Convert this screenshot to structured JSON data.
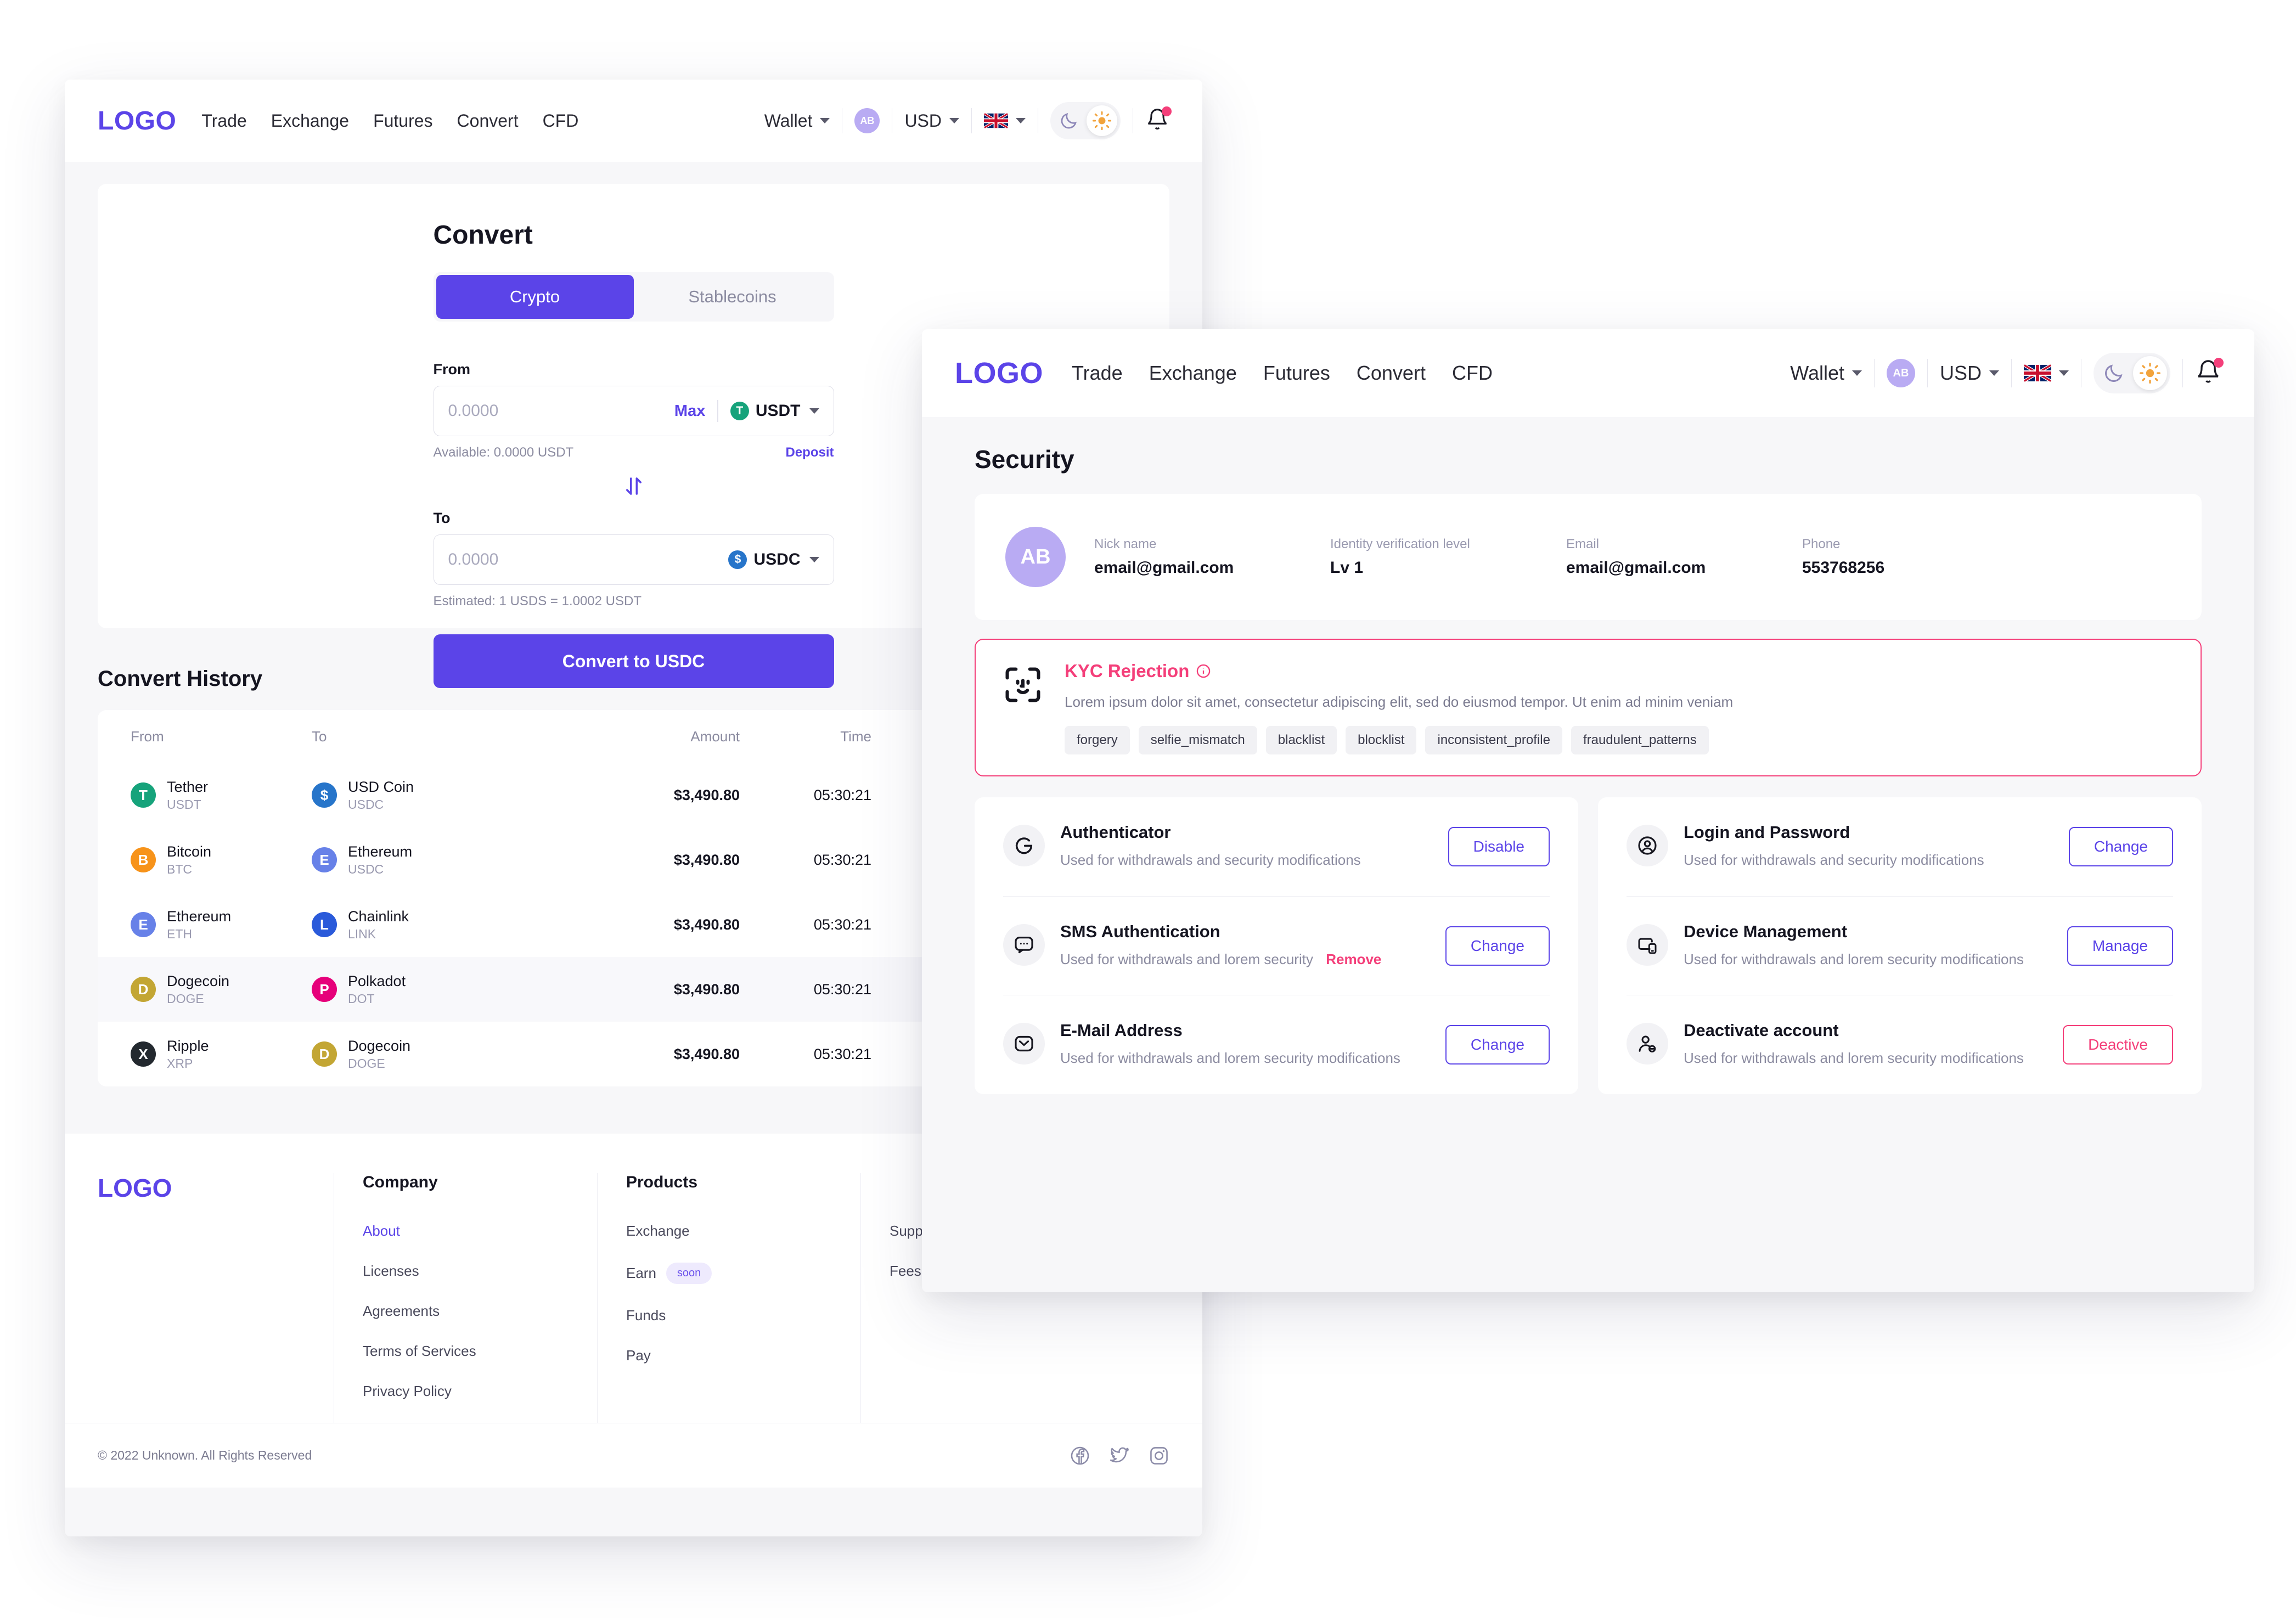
{
  "colors": {
    "accent": "#5b44e8",
    "danger": "#f43f7a",
    "muted": "#8b8ba0"
  },
  "nav": {
    "logo": "LOGO",
    "links": [
      "Trade",
      "Exchange",
      "Futures",
      "Convert",
      "CFD"
    ],
    "wallet": "Wallet",
    "avatar_initials": "AB",
    "currency": "USD",
    "language_icon": "uk-flag-icon",
    "moon_icon": "moon-icon",
    "sun_icon": "sun-icon",
    "bell_icon": "bell-icon"
  },
  "convert": {
    "title": "Convert",
    "tabs": [
      {
        "label": "Crypto",
        "active": true
      },
      {
        "label": "Stablecoins",
        "active": false
      }
    ],
    "from": {
      "label": "From",
      "placeholder": "0.0000",
      "value": "",
      "max_label": "Max",
      "coin": "USDT",
      "coin_color": "#16a37b",
      "coin_glyph": "T",
      "available": "Available: 0.0000 USDT",
      "deposit_label": "Deposit"
    },
    "swap_icon": "swap-vertical-icon",
    "to": {
      "label": "To",
      "placeholder": "0.0000",
      "value": "",
      "coin": "USDC",
      "coin_color": "#2775ca",
      "coin_glyph": "$",
      "estimated": "Estimated: 1 USDS = 1.0002 USDT"
    },
    "cta_label": "Convert to USDC"
  },
  "history": {
    "title": "Convert History",
    "columns": [
      "From",
      "To",
      "Amount",
      "Time"
    ],
    "rows": [
      {
        "from_name": "Tether",
        "from_sym": "USDT",
        "from_color": "#16a37b",
        "from_glyph": "T",
        "to_name": "USD Coin",
        "to_sym": "USDC",
        "to_color": "#2775ca",
        "to_glyph": "$",
        "amount": "$3,490.80",
        "time": "05:30:21"
      },
      {
        "from_name": "Bitcoin",
        "from_sym": "BTC",
        "from_color": "#f7931a",
        "from_glyph": "B",
        "to_name": "Ethereum",
        "to_sym": "USDC",
        "to_color": "#6781e8",
        "to_glyph": "E",
        "amount": "$3,490.80",
        "time": "05:30:21"
      },
      {
        "from_name": "Ethereum",
        "from_sym": "ETH",
        "from_color": "#6781e8",
        "from_glyph": "E",
        "to_name": "Chainlink",
        "to_sym": "LINK",
        "to_color": "#2a5ada",
        "to_glyph": "L",
        "amount": "$3,490.80",
        "time": "05:30:21"
      },
      {
        "from_name": "Dogecoin",
        "from_sym": "DOGE",
        "from_color": "#c3a634",
        "from_glyph": "D",
        "to_name": "Polkadot",
        "to_sym": "DOT",
        "to_color": "#e6007a",
        "to_glyph": "P",
        "amount": "$3,490.80",
        "time": "05:30:21"
      },
      {
        "from_name": "Ripple",
        "from_sym": "XRP",
        "from_color": "#23292f",
        "from_glyph": "X",
        "to_name": "Dogecoin",
        "to_sym": "DOGE",
        "to_color": "#c3a634",
        "to_glyph": "D",
        "amount": "$3,490.80",
        "time": "05:30:21"
      }
    ]
  },
  "footer": {
    "logo": "LOGO",
    "company": {
      "heading": "Company",
      "links": [
        {
          "label": "About",
          "active": true
        },
        {
          "label": "Licenses",
          "active": false
        },
        {
          "label": "Agreements",
          "active": false
        },
        {
          "label": "Terms of Services",
          "active": false
        },
        {
          "label": "Privacy Policy",
          "active": false
        }
      ]
    },
    "products": {
      "heading": "Products",
      "links": [
        {
          "label": "Exchange",
          "badge": ""
        },
        {
          "label": "Earn",
          "badge": "soon"
        },
        {
          "label": "Funds",
          "badge": ""
        },
        {
          "label": "Pay",
          "badge": ""
        }
      ]
    },
    "support": {
      "links": [
        {
          "label": "Support desk"
        },
        {
          "label": "Fees"
        }
      ]
    },
    "copyright": "© 2022 Unknown. All Rights Reserved",
    "socials": [
      "facebook-icon",
      "twitter-icon",
      "instagram-icon"
    ]
  },
  "security": {
    "title": "Security",
    "profile": {
      "avatar_initials": "AB",
      "fields": [
        {
          "label": "Nick name",
          "value": "email@gmail.com"
        },
        {
          "label": "Identity verification level",
          "value": "Lv 1"
        },
        {
          "label": "Email",
          "value": "email@gmail.com"
        },
        {
          "label": "Phone",
          "value": "553768256"
        }
      ]
    },
    "kyc": {
      "icon": "face-scan-icon",
      "title": "KYC Rejection",
      "info_icon": "info-icon",
      "description": "Lorem ipsum dolor sit amet, consectetur adipiscing elit, sed do eiusmod tempor. Ut enim ad minim veniam",
      "chips": [
        "forgery",
        "selfie_mismatch",
        "blacklist",
        "blocklist",
        "inconsistent_profile",
        "fraudulent_patterns"
      ]
    },
    "left_items": [
      {
        "icon": "google-authenticator-icon",
        "name": "Authenticator",
        "desc": "Used for withdrawals and security modifications",
        "remove": "",
        "button": "Disable",
        "button_style": "accent"
      },
      {
        "icon": "sms-chat-icon",
        "name": "SMS Authentication",
        "desc": "Used for withdrawals and lorem security",
        "remove": "Remove",
        "button": "Change",
        "button_style": "accent"
      },
      {
        "icon": "envelope-icon",
        "name": "E-Mail Address",
        "desc": "Used for withdrawals and lorem security modifications",
        "remove": "",
        "button": "Change",
        "button_style": "accent"
      }
    ],
    "right_items": [
      {
        "icon": "user-circle-icon",
        "name": "Login and Password",
        "desc": "Used for withdrawals and security modifications",
        "remove": "",
        "button": "Change",
        "button_style": "accent"
      },
      {
        "icon": "devices-icon",
        "name": "Device Management",
        "desc": "Used for withdrawals and lorem security modifications",
        "remove": "",
        "button": "Manage",
        "button_style": "accent"
      },
      {
        "icon": "user-remove-icon",
        "name": "Deactivate account",
        "desc": "Used for withdrawals and lorem security modifications",
        "remove": "",
        "button": "Deactive",
        "button_style": "danger"
      }
    ]
  }
}
